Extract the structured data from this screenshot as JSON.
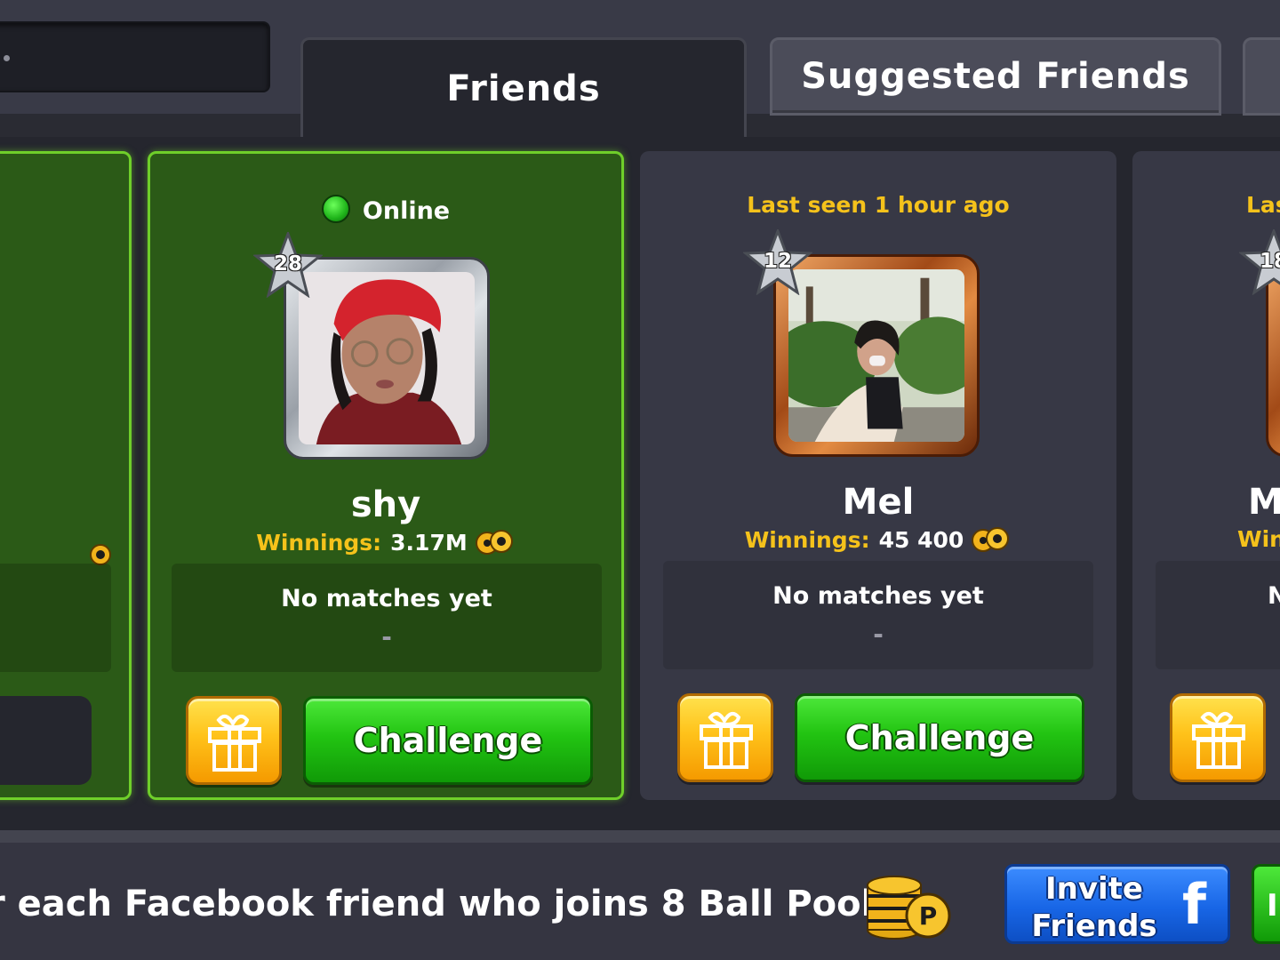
{
  "tabs": {
    "friends": "Friends",
    "suggested": "Suggested Friends"
  },
  "cards": {
    "left_partial": {},
    "shy": {
      "status": "Online",
      "level": "28",
      "name": "shy",
      "winnings_label": "Winnings:",
      "winnings_value": "3.17M",
      "matches": "No matches yet",
      "matches_dash": "-",
      "challenge": "Challenge"
    },
    "mel": {
      "status": "Last seen 1 hour ago",
      "level": "12",
      "name": "Mel",
      "winnings_label": "Winnings:",
      "winnings_value": "45 400",
      "matches": "No matches yet",
      "matches_dash": "-",
      "challenge": "Challenge"
    },
    "right_partial": {
      "status": "Las",
      "level": "18",
      "name": "M",
      "winnings_label": "Win",
      "matches": "N"
    }
  },
  "banner": {
    "promo_text": "r each Facebook friend who joins 8 Ball Pool!",
    "invite_label_line1": "Invite",
    "invite_label_line2": "Friends",
    "facebook_glyph": "f",
    "invite2_partial": "In"
  },
  "colors": {
    "online_card_bg": "#2b5a17",
    "online_card_border": "#6fcf2a",
    "gold_text": "#f5c21b",
    "challenge_green": "#22c412",
    "gift_orange": "#ffc21a",
    "invite_blue": "#1866e6"
  }
}
